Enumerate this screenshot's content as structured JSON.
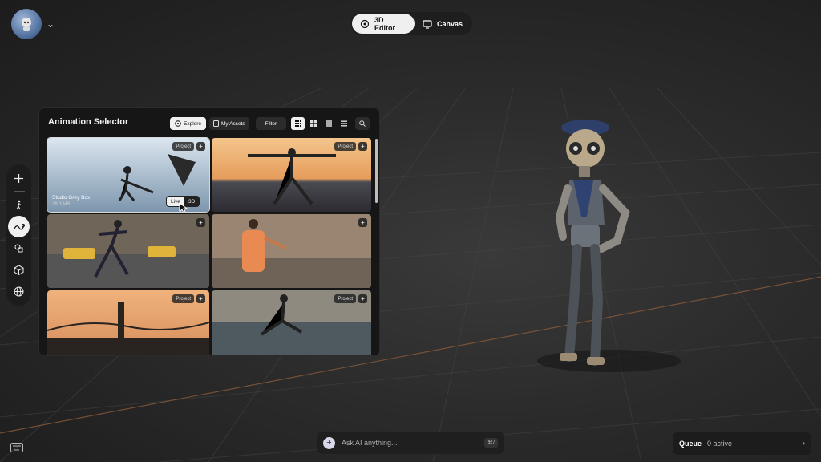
{
  "header": {
    "modes": [
      {
        "label": "3D Editor",
        "icon": "cube-target-icon",
        "active": true
      },
      {
        "label": "Canvas",
        "icon": "monitor-icon",
        "active": false
      }
    ]
  },
  "toolbar": {
    "items": [
      "plus-icon",
      "walking-person-icon",
      "motion-path-icon",
      "shapes-icon",
      "cube-icon",
      "globe-icon"
    ],
    "active": "motion-path-icon"
  },
  "panel": {
    "title": "Animation Selector",
    "tabs": {
      "explore": "Explore",
      "my_assets": "My Assets"
    },
    "filter_label": "Filter",
    "cards": [
      {
        "badge": "Project",
        "name": "Studio Grey Box",
        "size": "28.3 MB",
        "live": "Live",
        "three_d": "3D",
        "selected": true,
        "palette": [
          "#b7c9dc",
          "#6d8aa5"
        ]
      },
      {
        "badge": "Project",
        "palette": [
          "#f2b36a",
          "#3b3a3d"
        ]
      },
      {
        "badge": "",
        "palette": [
          "#8c7a6a",
          "#3d3a38"
        ]
      },
      {
        "badge": "",
        "palette": [
          "#b79a7b",
          "#5a4d42"
        ]
      },
      {
        "badge": "Project",
        "palette": [
          "#e6a06b",
          "#2a2421"
        ]
      },
      {
        "badge": "Project",
        "palette": [
          "#9aa3a8",
          "#3e3a33"
        ]
      }
    ]
  },
  "ask": {
    "placeholder": "Ask AI anything...",
    "shortcut": "⌘/"
  },
  "queue": {
    "label": "Queue",
    "count": "0 active"
  },
  "colors": {
    "accent_grid_line": "#8a5a3a",
    "panel_bg": "#161616"
  }
}
